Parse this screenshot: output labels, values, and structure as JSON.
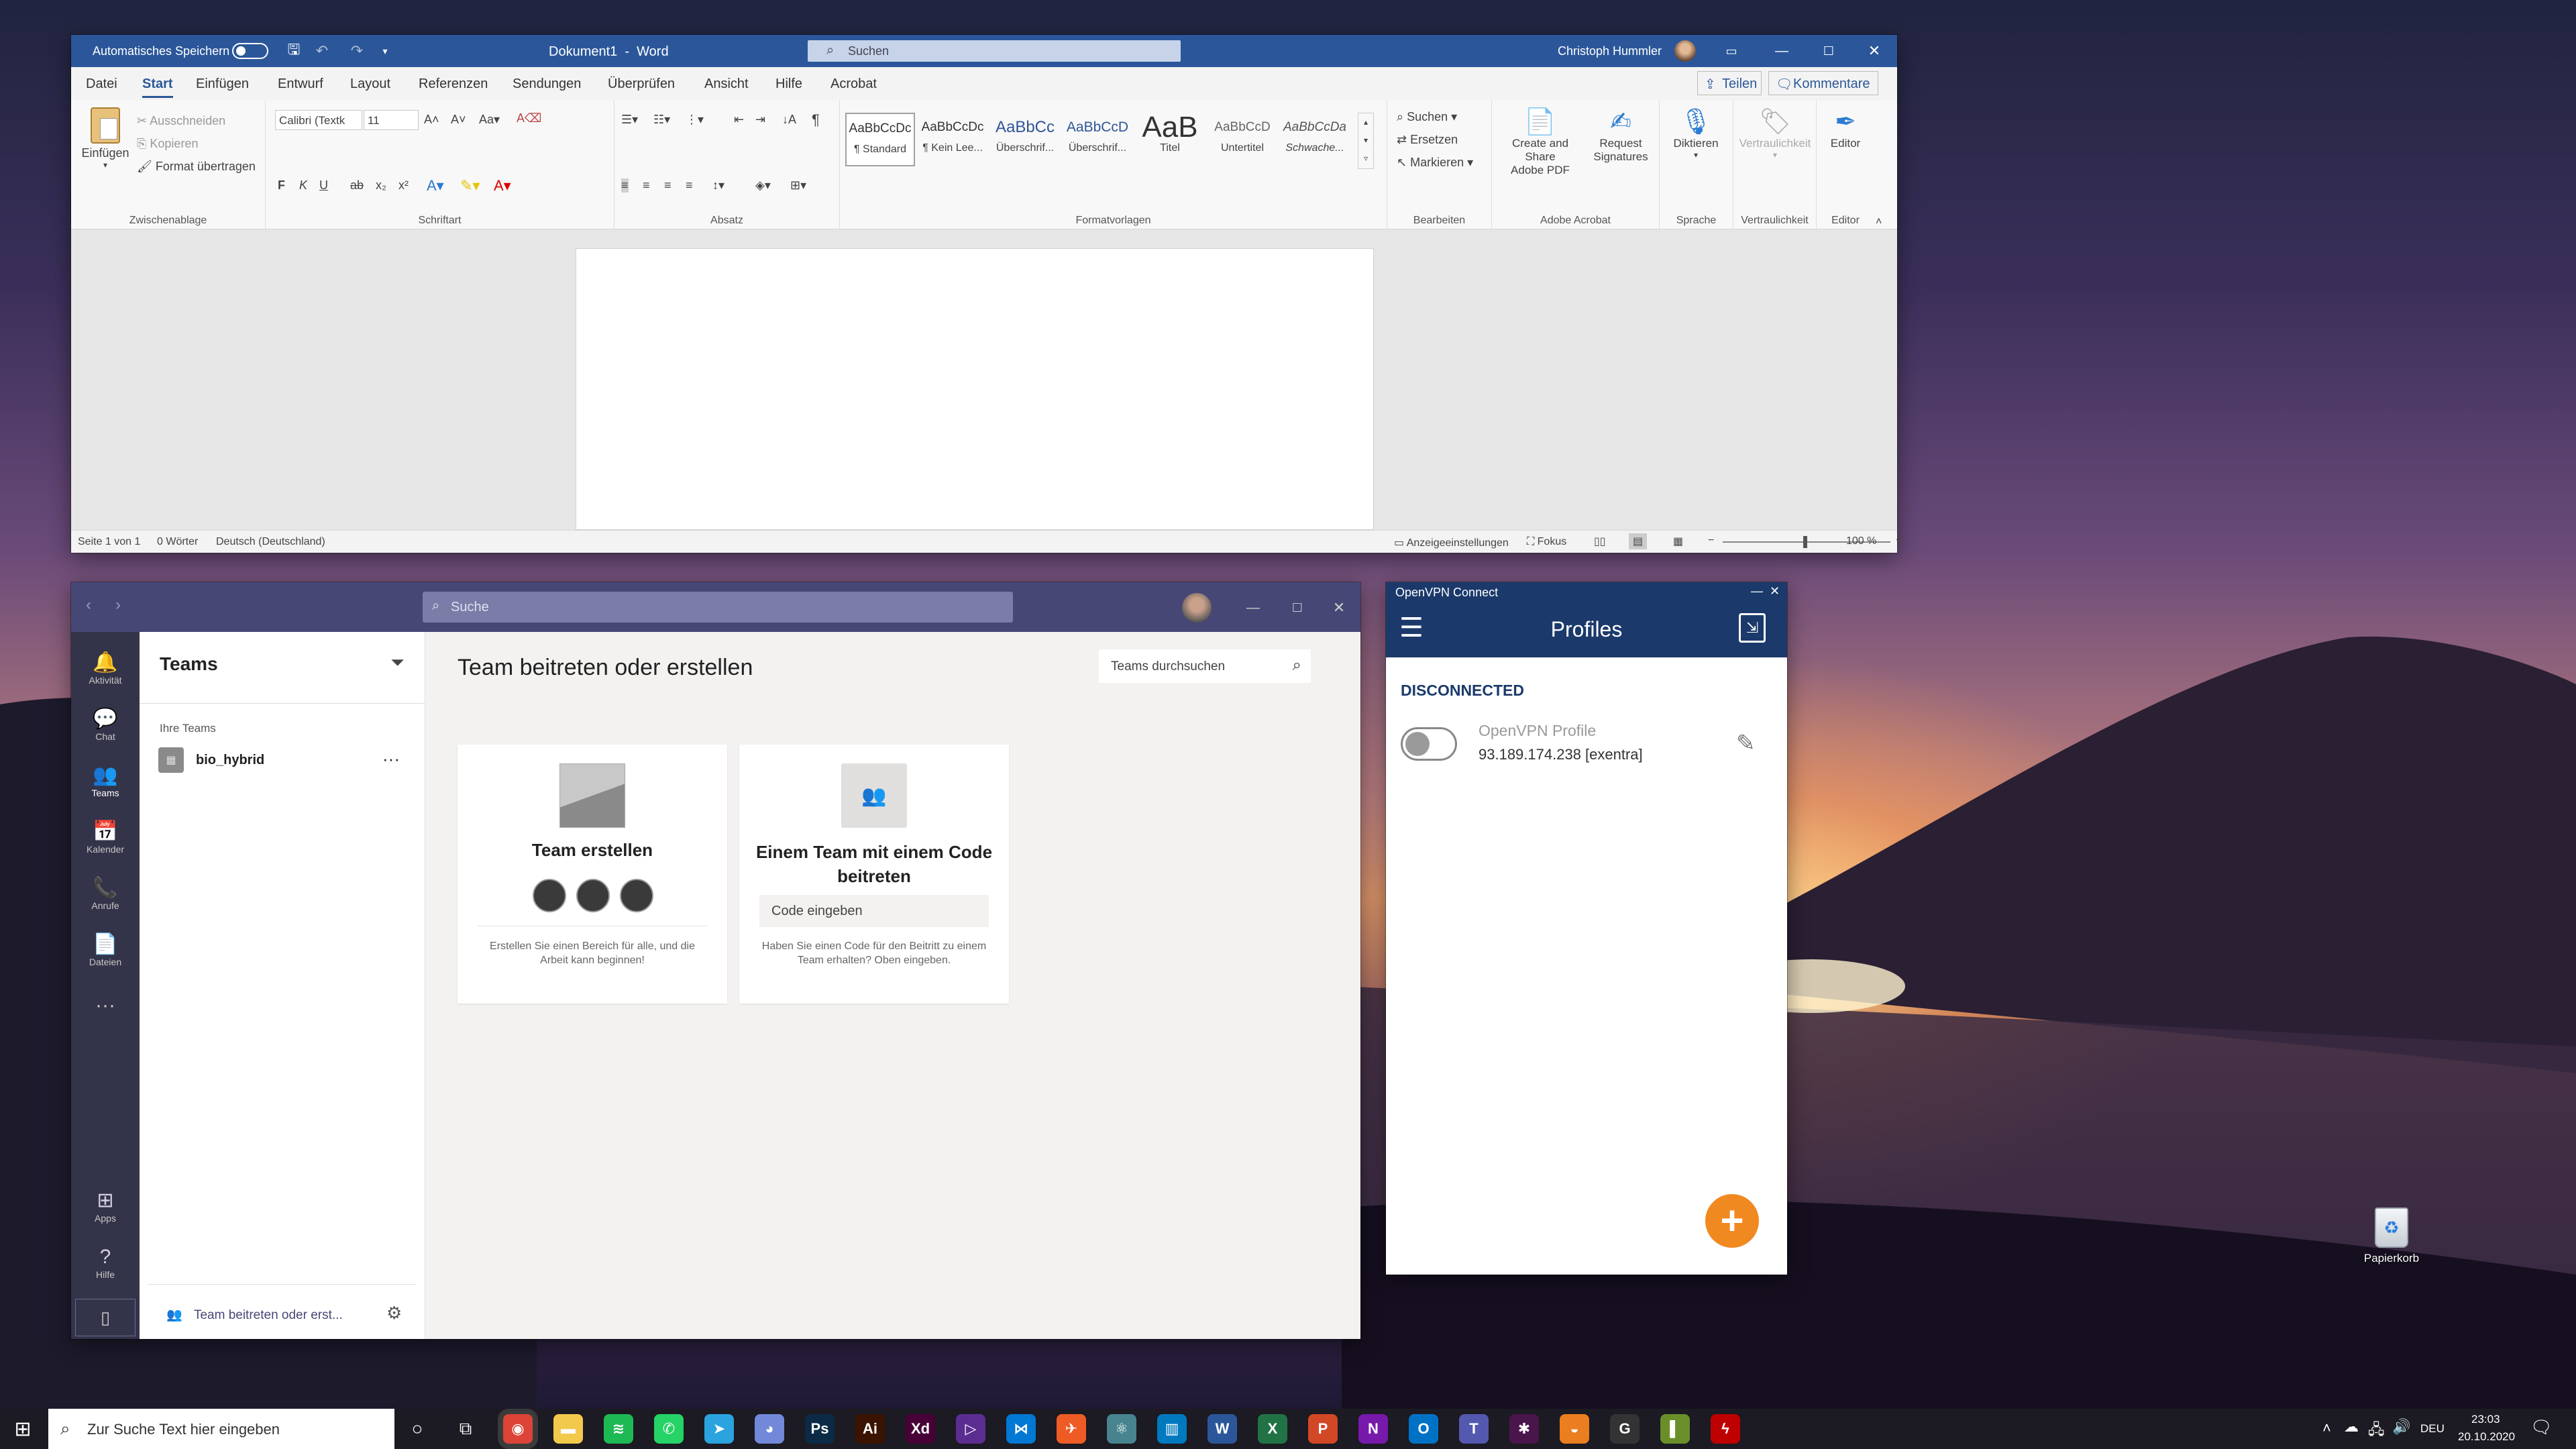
{
  "word": {
    "autosave_label": "Automatisches Speichern",
    "title": "Dokument1  -  Word",
    "search_placeholder": "Suchen",
    "user": "Christoph Hummler",
    "share": "Teilen",
    "comments": "Kommentare",
    "menu": [
      "Datei",
      "Start",
      "Einfügen",
      "Entwurf",
      "Layout",
      "Referenzen",
      "Sendungen",
      "Überprüfen",
      "Ansicht",
      "Hilfe",
      "Acrobat"
    ],
    "clipboard": {
      "paste": "Einfügen",
      "cut": "Ausschneiden",
      "copy": "Kopieren",
      "format": "Format übertragen",
      "label": "Zwischenablage"
    },
    "font": {
      "name": "Calibri (Textk",
      "size": "11",
      "label": "Schriftart"
    },
    "paragraph_label": "Absatz",
    "styles": [
      {
        "preview": "AaBbCcDc",
        "name": "¶ Standard"
      },
      {
        "preview": "AaBbCcDc",
        "name": "¶ Kein Lee..."
      },
      {
        "preview": "AaBbCc",
        "name": "Überschrif..."
      },
      {
        "preview": "AaBbCcD",
        "name": "Überschrif..."
      },
      {
        "preview": "AaB",
        "name": "Titel"
      },
      {
        "preview": "AaBbCcD",
        "name": "Untertitel"
      },
      {
        "preview": "AaBbCcDa",
        "name": "Schwache..."
      }
    ],
    "styles_label": "Formatvorlagen",
    "edit": {
      "find": "Suchen",
      "replace": "Ersetzen",
      "select": "Markieren",
      "label": "Bearbeiten"
    },
    "acrobat": {
      "create": "Create and Share",
      "create2": "Adobe PDF",
      "request": "Request",
      "request2": "Signatures",
      "label": "Adobe Acrobat"
    },
    "speech": {
      "dictate": "Diktieren",
      "label": "Sprache"
    },
    "sensitivity": {
      "btn": "Vertraulichkeit",
      "label": "Vertraulichkeit"
    },
    "editor": {
      "btn": "Editor",
      "label": "Editor"
    },
    "status": {
      "page": "Seite 1 von 1",
      "words": "0 Wörter",
      "lang": "Deutsch (Deutschland)",
      "display": "Anzeigeeinstellungen",
      "focus": "Fokus",
      "zoom": "100 %"
    }
  },
  "teams": {
    "search_placeholder": "Suche",
    "rail": [
      "Aktivität",
      "Chat",
      "Teams",
      "Kalender",
      "Anrufe",
      "Dateien"
    ],
    "rail_bottom": [
      "Apps",
      "Hilfe"
    ],
    "list_title": "Teams",
    "your_teams": "Ihre Teams",
    "team_name": "bio_hybrid",
    "join_link": "Team beitreten oder erst...",
    "heading": "Team beitreten oder erstellen",
    "search_teams": "Teams durchsuchen",
    "card1": {
      "title": "Team erstellen",
      "desc": "Erstellen Sie einen Bereich für alle, und die Arbeit kann beginnen!"
    },
    "card2": {
      "title": "Einem Team mit einem Code beitreten",
      "code_placeholder": "Code eingeben",
      "desc": "Haben Sie einen Code für den Beitritt zu einem Team erhalten? Oben eingeben."
    }
  },
  "vpn": {
    "window_title": "OpenVPN Connect",
    "header": "Profiles",
    "status": "DISCONNECTED",
    "profile_name": "OpenVPN Profile",
    "profile_addr": "93.189.174.238 [exentra]"
  },
  "desktop": {
    "recycle": "Papierkorb"
  },
  "taskbar": {
    "search": "Zur Suche Text hier eingeben",
    "lang": "DEU",
    "time": "23:03",
    "date": "20.10.2020",
    "apps": [
      {
        "name": "chrome",
        "label": "◉",
        "color": "#db4437"
      },
      {
        "name": "explorer",
        "label": "▬",
        "color": "#f2c94c"
      },
      {
        "name": "spotify",
        "label": "≋",
        "color": "#1db954"
      },
      {
        "name": "whatsapp",
        "label": "✆",
        "color": "#25d366"
      },
      {
        "name": "telegram",
        "label": "➤",
        "color": "#2aa3de"
      },
      {
        "name": "discord",
        "label": "◕",
        "color": "#7289da"
      },
      {
        "name": "photoshop",
        "label": "Ps",
        "color": "#0b2a45"
      },
      {
        "name": "illustrator",
        "label": "Ai",
        "color": "#3a1400"
      },
      {
        "name": "xd",
        "label": "Xd",
        "color": "#470137"
      },
      {
        "name": "visual-studio",
        "label": "▷",
        "color": "#5c2d91"
      },
      {
        "name": "vscode",
        "label": "⋈",
        "color": "#0078d4"
      },
      {
        "name": "postman",
        "label": "✈",
        "color": "#ef5b25"
      },
      {
        "name": "electron",
        "label": "⚛",
        "color": "#47848f"
      },
      {
        "name": "trello",
        "label": "▥",
        "color": "#0079bf"
      },
      {
        "name": "word",
        "label": "W",
        "color": "#2b579a"
      },
      {
        "name": "excel",
        "label": "X",
        "color": "#217346"
      },
      {
        "name": "powerpoint",
        "label": "P",
        "color": "#d24726"
      },
      {
        "name": "onenote",
        "label": "N",
        "color": "#7719aa"
      },
      {
        "name": "outlook",
        "label": "O",
        "color": "#0072c6"
      },
      {
        "name": "teams",
        "label": "T",
        "color": "#5558af"
      },
      {
        "name": "slack",
        "label": "✱",
        "color": "#4a154b"
      },
      {
        "name": "openvpn",
        "label": "◒",
        "color": "#ea7e20"
      },
      {
        "name": "g-app",
        "label": "G",
        "color": "#333333"
      },
      {
        "name": "file-app",
        "label": "▌",
        "color": "#6a8f2a"
      },
      {
        "name": "filezilla",
        "label": "ϟ",
        "color": "#bf0000"
      }
    ]
  }
}
